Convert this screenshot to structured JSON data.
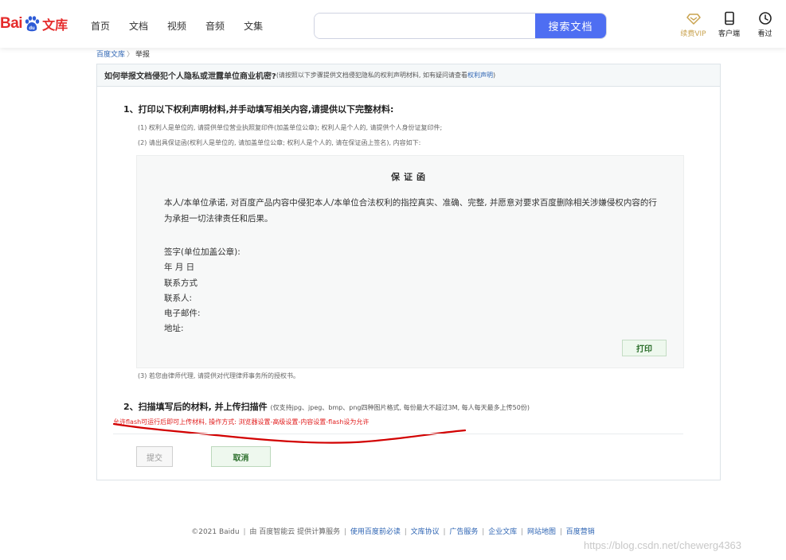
{
  "header": {
    "logo": {
      "bai": "Bai",
      "du": "du",
      "wenku": "文库"
    },
    "nav": [
      "首页",
      "文档",
      "视频",
      "音频",
      "文集"
    ],
    "search": {
      "value": "",
      "placeholder": "",
      "button": "搜索文档"
    },
    "tools": [
      {
        "label": "续费VIP",
        "icon": "diamond-icon"
      },
      {
        "label": "客户端",
        "icon": "device-icon"
      },
      {
        "label": "看过",
        "icon": "clock-icon"
      }
    ],
    "colors": {
      "brand_red": "#e52b2b",
      "search_blue": "#4e6ef2",
      "vip_gold": "#c9a34f"
    }
  },
  "breadcrumb": {
    "home": "百度文库",
    "sep": "〉",
    "current": "举报"
  },
  "panel": {
    "question": "如何举报文档侵犯个人隐私或泄露单位商业机密?",
    "question_note": "(请按照以下步骤提供文档侵犯隐私的权利声明材料, 如有疑问请查看",
    "question_link": "权利声明",
    "question_note_end": ")"
  },
  "step1": {
    "title": "1、打印以下权利声明材料,并手动填写相关内容,请提供以下完整材料:",
    "notes": [
      "(1) 权利人是单位的, 请提供单位营业执照复印件(加盖单位公章); 权利人是个人的, 请提供个人身份证复印件;",
      "(2) 请出具保证函(权利人是单位的, 请加盖单位公章; 权利人是个人的, 请在保证函上签名), 内容如下:"
    ],
    "note3": "(3) 若您由律师代理, 请提供对代理律师事务所的授权书。"
  },
  "letter": {
    "title": "保证函",
    "body": "本人/本单位承诺, 对百度产品内容中侵犯本人/本单位合法权利的指控真实、准确、完整, 并愿意对要求百度删除相关涉嫌侵权内容的行为承担一切法律责任和后果。",
    "fields": [
      "签字(单位加盖公章):",
      "年 月 日",
      "联系方式",
      "联系人:",
      "电子邮件:",
      "地址:"
    ],
    "print_button": "打印"
  },
  "step2": {
    "title": "2、扫描填写后的材料, 并上传扫描件",
    "note": "(仅支持jpg、jpeg、bmp、png四种图片格式, 每份最大不超过3M, 每人每天最多上传50份)",
    "flash_warning": "允许flash可运行后即可上传材料, 操作方式: 浏览器设置-高级设置-内容设置-flash设为允许"
  },
  "actions": {
    "submit": "提交",
    "cancel": "取消"
  },
  "footer": {
    "copyright": "©2021 Baidu",
    "provider": "由 百度智能云 提供计算服务",
    "links": [
      "使用百度前必读",
      "文库协议",
      "广告服务",
      "企业文库",
      "网站地图",
      "百度营销"
    ]
  },
  "watermark": "https://blog.csdn.net/chewerg4363"
}
